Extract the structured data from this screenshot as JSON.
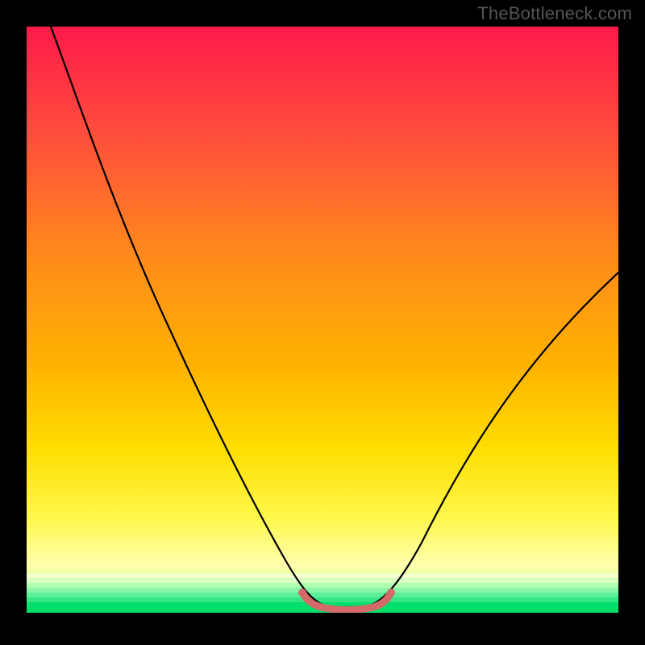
{
  "watermark": "TheBottleneck.com",
  "chart_data": {
    "type": "line",
    "title": "",
    "xlabel": "",
    "ylabel": "",
    "xlim": [
      0,
      100
    ],
    "ylim": [
      0,
      100
    ],
    "grid": false,
    "legend": false,
    "background": {
      "type": "vertical-gradient",
      "stops": [
        {
          "pos": 0,
          "color": "#ff1a4a"
        },
        {
          "pos": 50,
          "color": "#ffa500"
        },
        {
          "pos": 78,
          "color": "#ffe600"
        },
        {
          "pos": 92,
          "color": "#ffff66"
        },
        {
          "pos": 100,
          "color": "#00e06a"
        }
      ]
    },
    "series": [
      {
        "name": "bottleneck-curve",
        "color": "#000000",
        "points": [
          {
            "x": 4,
            "y": 100
          },
          {
            "x": 10,
            "y": 82
          },
          {
            "x": 18,
            "y": 62
          },
          {
            "x": 26,
            "y": 44
          },
          {
            "x": 34,
            "y": 27
          },
          {
            "x": 40,
            "y": 14
          },
          {
            "x": 45,
            "y": 5
          },
          {
            "x": 48,
            "y": 1
          },
          {
            "x": 52,
            "y": 0
          },
          {
            "x": 56,
            "y": 0
          },
          {
            "x": 60,
            "y": 1
          },
          {
            "x": 64,
            "y": 6
          },
          {
            "x": 70,
            "y": 16
          },
          {
            "x": 78,
            "y": 30
          },
          {
            "x": 86,
            "y": 42
          },
          {
            "x": 94,
            "y": 52
          },
          {
            "x": 100,
            "y": 58
          }
        ]
      },
      {
        "name": "optimal-region-marker",
        "color": "#d35a5a",
        "points": [
          {
            "x": 47,
            "y": 2
          },
          {
            "x": 49,
            "y": 0.5
          },
          {
            "x": 52,
            "y": 0
          },
          {
            "x": 55,
            "y": 0
          },
          {
            "x": 58,
            "y": 0.5
          },
          {
            "x": 60,
            "y": 2
          }
        ]
      }
    ]
  }
}
